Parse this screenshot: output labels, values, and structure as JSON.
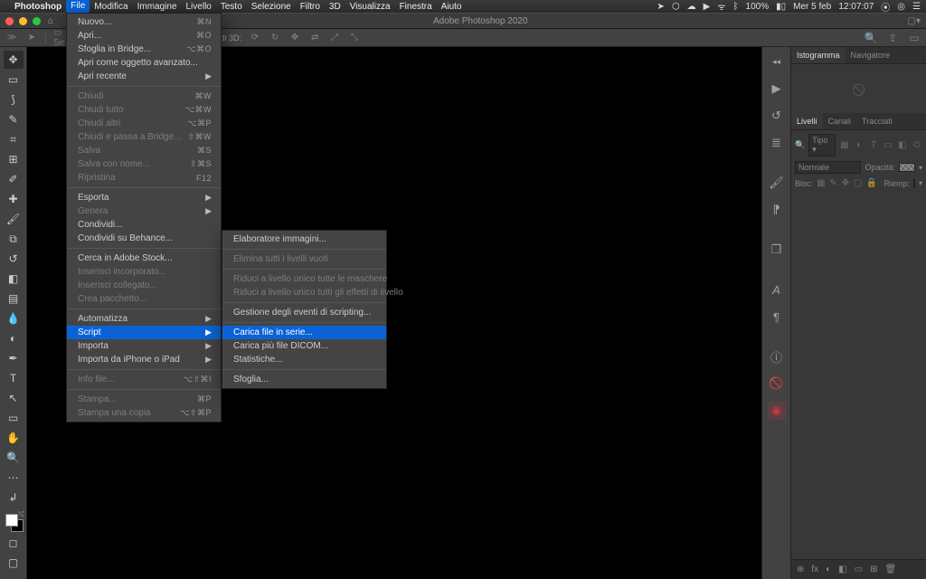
{
  "menubar": {
    "app": "Photoshop",
    "items": [
      "File",
      "Modifica",
      "Immagine",
      "Livello",
      "Testo",
      "Selezione",
      "Filtro",
      "3D",
      "Visualizza",
      "Finestra",
      "Aiuto"
    ],
    "open_index": 0,
    "right": {
      "battery": "100%",
      "date": "Mer 5 feb",
      "time": "12:07:07"
    }
  },
  "window": {
    "title": "Adobe Photoshop 2020"
  },
  "options": {
    "mode": "3D",
    "opt_label": "Modi 3D:"
  },
  "file_menu": [
    {
      "kind": "item",
      "label": "Nuovo...",
      "shortcut": "⌘N"
    },
    {
      "kind": "item",
      "label": "Apri...",
      "shortcut": "⌘O"
    },
    {
      "kind": "item",
      "label": "Sfoglia in Bridge...",
      "shortcut": "⌥⌘O"
    },
    {
      "kind": "item",
      "label": "Apri come oggetto avanzato..."
    },
    {
      "kind": "sub",
      "label": "Apri recente"
    },
    {
      "kind": "sep"
    },
    {
      "kind": "disabled",
      "label": "Chiudi",
      "shortcut": "⌘W"
    },
    {
      "kind": "disabled",
      "label": "Chiudi tutto",
      "shortcut": "⌥⌘W"
    },
    {
      "kind": "disabled",
      "label": "Chiudi altri",
      "shortcut": "⌥⌘P"
    },
    {
      "kind": "disabled",
      "label": "Chiudi e passa a Bridge...",
      "shortcut": "⇧⌘W"
    },
    {
      "kind": "disabled",
      "label": "Salva",
      "shortcut": "⌘S"
    },
    {
      "kind": "disabled",
      "label": "Salva con nome...",
      "shortcut": "⇧⌘S"
    },
    {
      "kind": "disabled",
      "label": "Ripristina",
      "shortcut": "F12"
    },
    {
      "kind": "sep"
    },
    {
      "kind": "sub",
      "label": "Esporta"
    },
    {
      "kind": "sub-disabled",
      "label": "Genera"
    },
    {
      "kind": "item",
      "label": "Condividi..."
    },
    {
      "kind": "item",
      "label": "Condividi su Behance..."
    },
    {
      "kind": "sep"
    },
    {
      "kind": "item",
      "label": "Cerca in Adobe Stock..."
    },
    {
      "kind": "disabled",
      "label": "Inserisci incorporato..."
    },
    {
      "kind": "disabled",
      "label": "Inserisci collegato..."
    },
    {
      "kind": "disabled",
      "label": "Crea pacchetto..."
    },
    {
      "kind": "sep"
    },
    {
      "kind": "sub",
      "label": "Automatizza"
    },
    {
      "kind": "sub-highlight",
      "label": "Script"
    },
    {
      "kind": "sub",
      "label": "Importa"
    },
    {
      "kind": "sub",
      "label": "Importa da iPhone o iPad"
    },
    {
      "kind": "sep"
    },
    {
      "kind": "disabled",
      "label": "Info file...",
      "shortcut": "⌥⇧⌘I"
    },
    {
      "kind": "sep"
    },
    {
      "kind": "disabled",
      "label": "Stampa...",
      "shortcut": "⌘P"
    },
    {
      "kind": "disabled",
      "label": "Stampa una copia",
      "shortcut": "⌥⇧⌘P"
    }
  ],
  "script_sub": [
    {
      "kind": "item",
      "label": "Elaboratore immagini..."
    },
    {
      "kind": "sep"
    },
    {
      "kind": "disabled",
      "label": "Elimina tutti i livelli vuoti"
    },
    {
      "kind": "sep"
    },
    {
      "kind": "disabled",
      "label": "Riduci a livello unico tutte le maschere"
    },
    {
      "kind": "disabled",
      "label": "Riduci a livello unico tutti gli effetti di livello"
    },
    {
      "kind": "sep"
    },
    {
      "kind": "item",
      "label": "Gestione degli eventi di scripting..."
    },
    {
      "kind": "sep"
    },
    {
      "kind": "highlight",
      "label": "Carica file in serie..."
    },
    {
      "kind": "item",
      "label": "Carica più file DICOM..."
    },
    {
      "kind": "item",
      "label": "Statistiche..."
    },
    {
      "kind": "sep"
    },
    {
      "kind": "item",
      "label": "Sfoglia..."
    }
  ],
  "panels": {
    "histo_tabs": [
      "Istogramma",
      "Navigatore"
    ],
    "layer_tabs": [
      "Livelli",
      "Canali",
      "Tracciati"
    ],
    "kind_label": "Tipo",
    "blend_label": "Normale",
    "opacity_label": "Opacità:",
    "lock_label": "Bloc:",
    "fill_label": "Riemp:",
    "footer": [
      "⊕",
      "fx",
      "◐",
      "◧",
      "▭",
      "⊞",
      "🗑"
    ]
  }
}
